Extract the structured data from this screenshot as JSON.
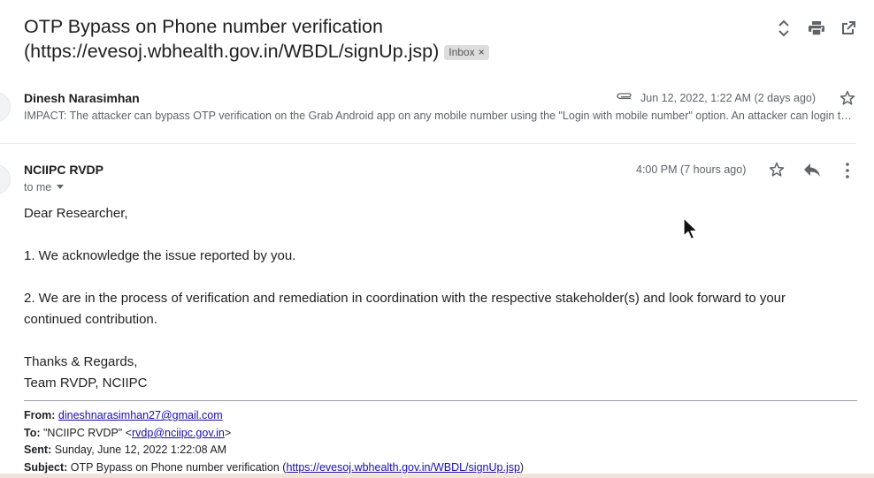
{
  "thread": {
    "subject_line1": "OTP Bypass on Phone number verification",
    "subject_line2": "(https://evesoj.wbhealth.gov.in/WBDL/signUp.jsp)",
    "label": "Inbox",
    "label_close": "×"
  },
  "toolbar": {
    "icons": [
      "expand-collapse-icon",
      "print-icon",
      "open-new-window-icon"
    ]
  },
  "message1": {
    "sender": "Dinesh Narasimhan",
    "date": "Jun 12, 2022, 1:22 AM (2 days ago)",
    "snippet": "IMPACT: The attacker can bypass OTP verification on the Grab Android app on any mobile number using the \"Login with mobile number\" option. An attacker can login to any account"
  },
  "message2": {
    "sender": "NCIIPC RVDP",
    "recipient": "to me",
    "date": "4:00 PM (7 hours ago)",
    "body": [
      "Dear Researcher,",
      "1. We acknowledge the issue reported by you.",
      "2. We are in the process of verification and remediation in coordination with the respective stakeholder(s) and look forward to your continued contribution.",
      "Thanks & Regards,",
      "Team RVDP, NCIIPC"
    ],
    "quoted": {
      "from_label": "From:",
      "from_email": "dineshnarasimhan27@gmail.com",
      "to_label": "To:",
      "to_name": "\"NCIIPC RVDP\" <",
      "to_email": "rvdp@nciipc.gov.in",
      "to_close": ">",
      "sent_label": "Sent:",
      "sent_value": "Sunday, June 12, 2022 1:22:08 AM",
      "subject_label": "Subject:",
      "subject_value": "OTP Bypass on Phone number verification (",
      "subject_link": "https://evesoj.wbhealth.gov.in/WBDL/signUp.jsp",
      "subject_close": ")"
    }
  }
}
